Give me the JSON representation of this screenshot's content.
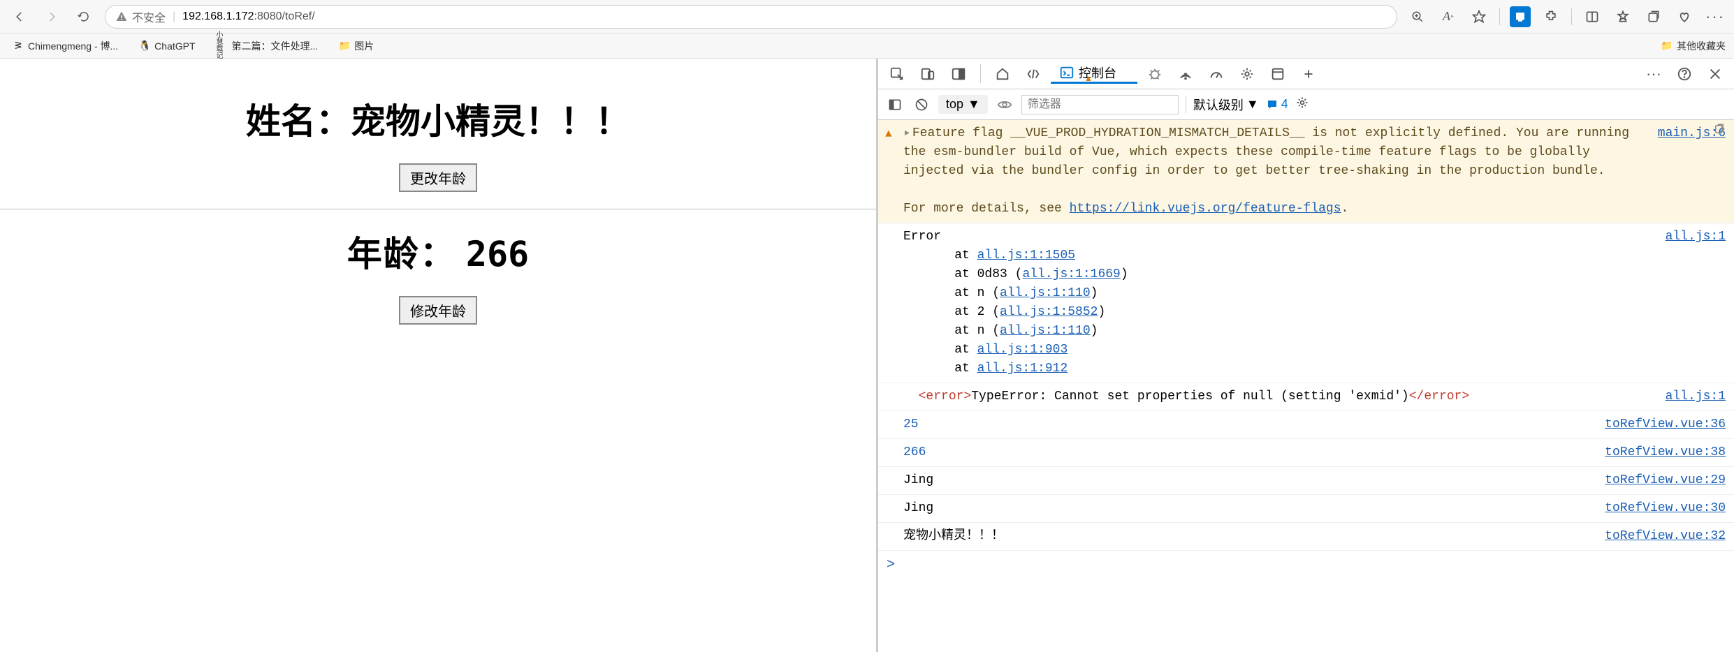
{
  "browser": {
    "security_label": "不安全",
    "url_host": "192.168.1.172",
    "url_port": ":8080",
    "url_path": "/toRef/"
  },
  "bookmarks": {
    "items": [
      {
        "label": "Chimengmeng - 博...",
        "icon": "user"
      },
      {
        "label": "ChatGPT",
        "icon": "penguin"
      },
      {
        "label": "第二篇：文件处理...",
        "icon": "text"
      },
      {
        "label": "图片",
        "icon": "folder"
      }
    ],
    "other_label": "其他收藏夹"
  },
  "page": {
    "name_label": "姓名：",
    "name_value": "宠物小精灵！！！",
    "btn_change_age": "更改年龄",
    "age_label": "年龄：",
    "age_value": "266",
    "btn_modify_age": "修改年龄"
  },
  "devtools": {
    "tab_console_label": "控制台",
    "ctb_top": "top",
    "ctb_filter_placeholder": "筛选器",
    "ctb_level": "默认级别",
    "ctb_issues_count": "4"
  },
  "console": {
    "warn": {
      "text1": "Feature flag __VUE_PROD_HYDRATION_MISMATCH_DETAILS__ is not explicitly defined. You are running the esm-bundler build of Vue, which expects these compile-time feature flags to be globally injected via the bundler config in order to get better tree-shaking in the production bundle.",
      "text2": "For more details, see ",
      "link": "https://link.vuejs.org/feature-flags",
      "src": "main.js:6"
    },
    "error": {
      "head": "Error",
      "stack": [
        {
          "prefix": "    at ",
          "link": "all.js:1:1505",
          "suffix": ""
        },
        {
          "prefix": "    at 0d83 (",
          "link": "all.js:1:1669",
          "suffix": ")"
        },
        {
          "prefix": "    at n (",
          "link": "all.js:1:110",
          "suffix": ")"
        },
        {
          "prefix": "    at 2 (",
          "link": "all.js:1:5852",
          "suffix": ")"
        },
        {
          "prefix": "    at n (",
          "link": "all.js:1:110",
          "suffix": ")"
        },
        {
          "prefix": "    at ",
          "link": "all.js:1:903",
          "suffix": ""
        },
        {
          "prefix": "    at ",
          "link": "all.js:1:912",
          "suffix": ""
        }
      ],
      "src": "all.js:1"
    },
    "typeerror": {
      "text": "TypeError: Cannot set properties of null (setting 'exmid')",
      "src": "all.js:1"
    },
    "logs": [
      {
        "val": "25",
        "src": "toRefView.vue:36",
        "numeric": true
      },
      {
        "val": "266",
        "src": "toRefView.vue:38",
        "numeric": true
      },
      {
        "val": "Jing",
        "src": "toRefView.vue:29",
        "numeric": false
      },
      {
        "val": "Jing",
        "src": "toRefView.vue:30",
        "numeric": false
      },
      {
        "val": "宠物小精灵！！！",
        "src": "toRefView.vue:32",
        "numeric": false
      }
    ]
  }
}
